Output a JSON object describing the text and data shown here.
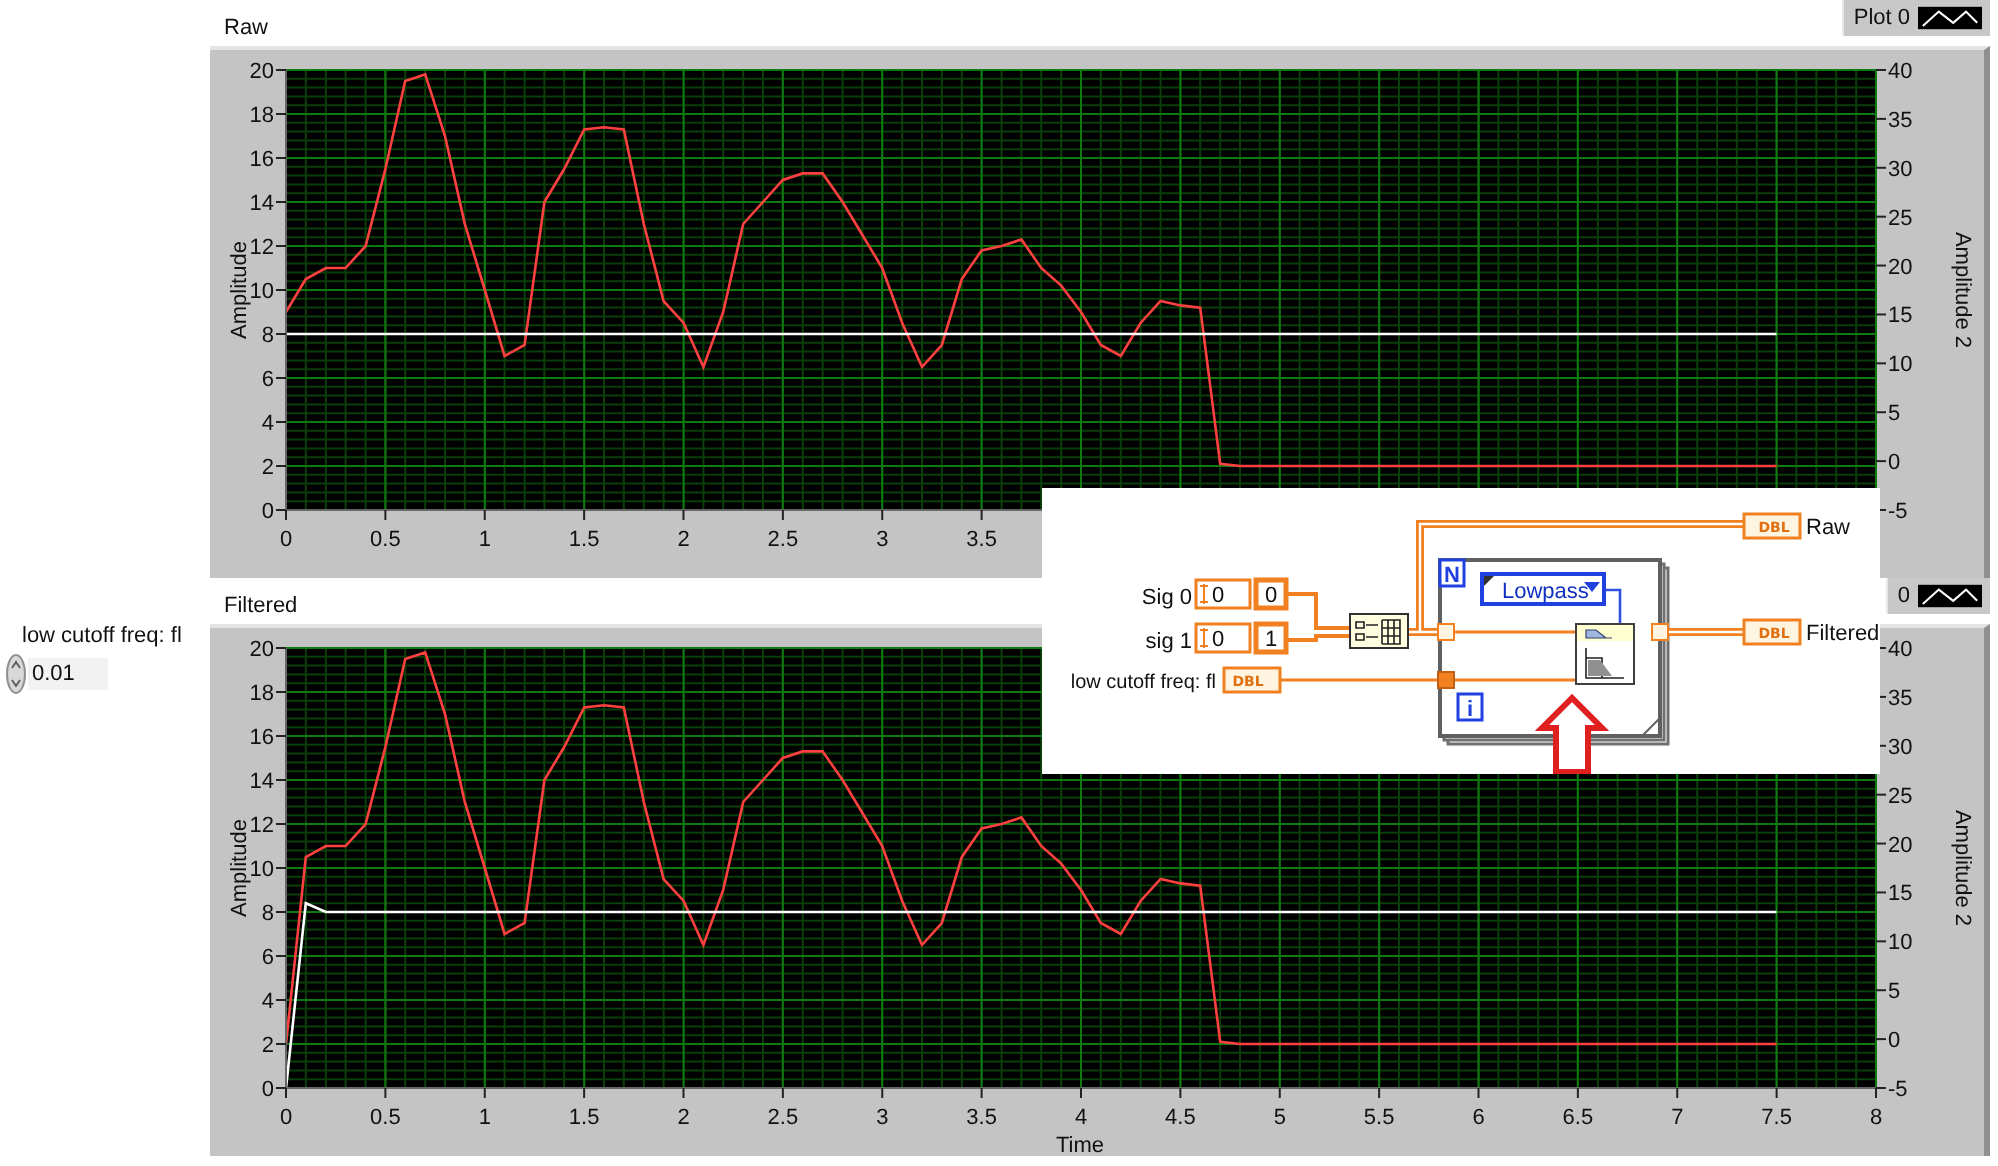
{
  "control": {
    "label": "low cutoff freq: fl",
    "value": "0.01"
  },
  "charts": [
    {
      "label": "Raw",
      "legend": "Plot 0",
      "chart_data": {
        "type": "line",
        "grid": true,
        "ylabel": "Amplitude",
        "y2label": "Amplitude 2",
        "x": [
          0,
          0.1,
          0.2,
          0.3,
          0.4,
          0.5,
          0.6,
          0.7,
          0.8,
          0.9,
          1,
          1.1,
          1.2,
          1.3,
          1.4,
          1.5,
          1.6,
          1.7,
          1.8,
          1.9,
          2,
          2.1,
          2.2,
          2.3,
          2.4,
          2.5,
          2.6,
          2.7,
          2.8,
          2.9,
          3,
          3.1,
          3.2,
          3.3,
          3.4,
          3.5,
          3.6,
          3.7,
          3.8,
          3.9,
          4,
          4.1,
          4.2,
          4.3,
          4.4,
          4.5,
          4.6,
          4.7,
          4.8,
          4.9,
          5,
          5.1,
          5.2,
          5.3,
          5.4,
          5.5,
          5.6,
          5.7,
          5.8,
          5.9,
          6,
          6.1,
          6.2,
          6.3,
          6.4,
          6.5,
          6.6,
          6.7,
          6.8,
          6.9,
          7,
          7.1,
          7.2,
          7.3,
          7.4,
          7.5
        ],
        "series": [
          {
            "color": "#ff4040",
            "values": [
              9,
              10.5,
              11,
              11,
              12,
              15.5,
              19.5,
              19.8,
              17,
              13,
              10,
              7,
              7.5,
              14,
              15.5,
              17.3,
              17.4,
              17.3,
              13,
              9.5,
              8.5,
              6.5,
              9,
              13,
              14,
              15,
              15.3,
              15.3,
              14,
              12.5,
              11,
              8.5,
              6.5,
              7.5,
              10.5,
              11.8,
              12,
              12.3,
              11,
              10.2,
              9,
              7.5,
              7,
              8.5,
              9.5,
              9.3,
              9.2,
              2.1,
              2,
              2,
              2,
              2,
              2,
              2,
              2,
              2,
              2,
              2,
              2,
              2,
              2,
              2,
              2,
              2,
              2,
              2,
              2,
              2,
              2,
              2,
              2,
              2,
              2,
              2,
              2,
              2
            ]
          },
          {
            "color": "#ffffff",
            "values": [
              8,
              8,
              8,
              8,
              8,
              8,
              8,
              8,
              8,
              8,
              8,
              8,
              8,
              8,
              8,
              8,
              8,
              8,
              8,
              8,
              8,
              8,
              8,
              8,
              8,
              8,
              8,
              8,
              8,
              8,
              8,
              8,
              8,
              8,
              8,
              8,
              8,
              8,
              8,
              8,
              8,
              8,
              8,
              8,
              8,
              8,
              8,
              8,
              8,
              8,
              8,
              8,
              8,
              8,
              8,
              8,
              8,
              8,
              8,
              8,
              8,
              8,
              8,
              8,
              8,
              8,
              8,
              8,
              8,
              8,
              8,
              8,
              8,
              8,
              8,
              8
            ]
          }
        ],
        "xlim": [
          0,
          8
        ],
        "ylim": [
          0,
          20
        ],
        "y2lim": [
          -5,
          40
        ],
        "xticks": [
          0,
          0.5,
          1,
          1.5,
          2,
          2.5,
          3,
          3.5
        ],
        "yticks": [
          0,
          2,
          4,
          6,
          8,
          10,
          12,
          14,
          16,
          18,
          20
        ],
        "y2ticks": [
          -5,
          0,
          5,
          10,
          15,
          20,
          25,
          30,
          35,
          40
        ]
      }
    },
    {
      "label": "Filtered",
      "legend": "0",
      "chart_data": {
        "type": "line",
        "grid": true,
        "xlabel": "Time",
        "ylabel": "Amplitude",
        "y2label": "Amplitude 2",
        "x": [
          0,
          0.1,
          0.2,
          0.3,
          0.4,
          0.5,
          0.6,
          0.7,
          0.8,
          0.9,
          1,
          1.1,
          1.2,
          1.3,
          1.4,
          1.5,
          1.6,
          1.7,
          1.8,
          1.9,
          2,
          2.1,
          2.2,
          2.3,
          2.4,
          2.5,
          2.6,
          2.7,
          2.8,
          2.9,
          3,
          3.1,
          3.2,
          3.3,
          3.4,
          3.5,
          3.6,
          3.7,
          3.8,
          3.9,
          4,
          4.1,
          4.2,
          4.3,
          4.4,
          4.5,
          4.6,
          4.7,
          4.8,
          4.9,
          5,
          5.1,
          5.2,
          5.3,
          5.4,
          5.5,
          5.6,
          5.7,
          5.8,
          5.9,
          6,
          6.1,
          6.2,
          6.3,
          6.4,
          6.5,
          6.6,
          6.7,
          6.8,
          6.9,
          7,
          7.1,
          7.2,
          7.3,
          7.4,
          7.5
        ],
        "series": [
          {
            "color": "#ff4040",
            "values": [
              2,
              10.5,
              11,
              11,
              12,
              15.5,
              19.5,
              19.8,
              17,
              13,
              10,
              7,
              7.5,
              14,
              15.5,
              17.3,
              17.4,
              17.3,
              13,
              9.5,
              8.5,
              6.5,
              9,
              13,
              14,
              15,
              15.3,
              15.3,
              14,
              12.5,
              11,
              8.5,
              6.5,
              7.5,
              10.5,
              11.8,
              12,
              12.3,
              11,
              10.2,
              9,
              7.5,
              7,
              8.5,
              9.5,
              9.3,
              9.2,
              2.1,
              2,
              2,
              2,
              2,
              2,
              2,
              2,
              2,
              2,
              2,
              2,
              2,
              2,
              2,
              2,
              2,
              2,
              2,
              2,
              2,
              2,
              2,
              2,
              2,
              2,
              2,
              2,
              2
            ]
          },
          {
            "color": "#ffffff",
            "values": [
              0,
              8.4,
              8,
              8,
              8,
              8,
              8,
              8,
              8,
              8,
              8,
              8,
              8,
              8,
              8,
              8,
              8,
              8,
              8,
              8,
              8,
              8,
              8,
              8,
              8,
              8,
              8,
              8,
              8,
              8,
              8,
              8,
              8,
              8,
              8,
              8,
              8,
              8,
              8,
              8,
              8,
              8,
              8,
              8,
              8,
              8,
              8,
              8,
              8,
              8,
              8,
              8,
              8,
              8,
              8,
              8,
              8,
              8,
              8,
              8,
              8,
              8,
              8,
              8,
              8,
              8,
              8,
              8,
              8,
              8,
              8,
              8,
              8,
              8,
              8,
              8
            ]
          }
        ],
        "xlim": [
          0,
          8
        ],
        "ylim": [
          0,
          20
        ],
        "y2lim": [
          -5,
          40
        ],
        "xticks": [
          0,
          0.5,
          1,
          1.5,
          2,
          2.5,
          3,
          3.5,
          4,
          4.5,
          5,
          5.5,
          6,
          6.5,
          7,
          7.5,
          8
        ],
        "yticks": [
          0,
          2,
          4,
          6,
          8,
          10,
          12,
          14,
          16,
          18,
          20
        ],
        "y2ticks": [
          -5,
          0,
          5,
          10,
          15,
          20,
          25,
          30,
          35,
          40
        ]
      }
    }
  ],
  "diagram": {
    "outputs": [
      {
        "type": "DBL",
        "label": "Raw"
      },
      {
        "type": "DBL",
        "label": "Filtered"
      }
    ],
    "inputs": [
      {
        "label": "Sig 0",
        "value": "0",
        "index": "0"
      },
      {
        "label": "sig 1",
        "value": "0",
        "index": "1"
      }
    ],
    "cutoff": {
      "label": "low cutoff freq: fl",
      "type": "DBL"
    },
    "loop": {
      "count": "N",
      "iteration": "i"
    },
    "filter_type": "Lowpass"
  }
}
